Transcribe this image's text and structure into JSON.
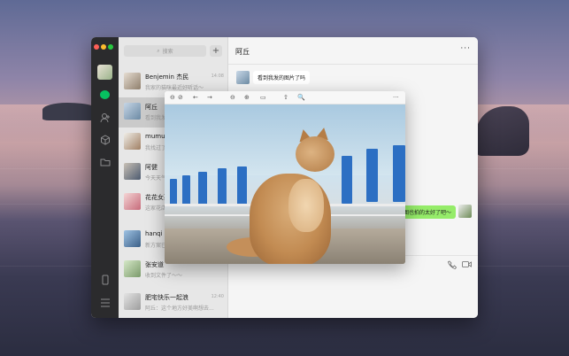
{
  "app": {
    "search_placeholder": "搜索",
    "add_label": "+"
  },
  "conversations": [
    {
      "name": "Benjemin 杰民",
      "time": "14:08",
      "preview": "我家的猫咪最近好听话～"
    },
    {
      "name": "阿丘",
      "time": "",
      "preview": "看到我发的图片了吗"
    },
    {
      "name": "mumu",
      "time": "",
      "preview": "我找过了"
    },
    {
      "name": "阿健",
      "time": "",
      "preview": "今天天气"
    },
    {
      "name": "花花女孩",
      "time": "",
      "preview": "这家花店"
    },
    {
      "name": "hanqi",
      "time": "",
      "preview": "新方案已"
    },
    {
      "name": "张安道",
      "time": "",
      "preview": "收到文件了～～"
    },
    {
      "name": "肥宅快乐一起浪",
      "time": "12:40",
      "preview": "阿丘：这个地方好美啊想去..."
    }
  ],
  "chat": {
    "title": "阿丘",
    "more": "···",
    "messages": [
      {
        "side": "left",
        "text": "看到我发的图片了吗"
      },
      {
        "side": "right",
        "text": "拍图也拍的太好了吧～"
      }
    ]
  },
  "viewer": {
    "toolbar": [
      "⊖",
      "⊘",
      "←",
      "→",
      "⊖",
      "⊕",
      "▭",
      "⇧",
      "🔍",
      "···"
    ]
  },
  "icons": {
    "chat": "chat-icon",
    "contacts": "contacts-icon",
    "favorites": "cube-icon",
    "files": "folder-icon",
    "phone": "phone-icon",
    "menu": "menu-icon"
  },
  "colors": {
    "accent": "#07c160",
    "bubble_self": "#95ec69"
  }
}
